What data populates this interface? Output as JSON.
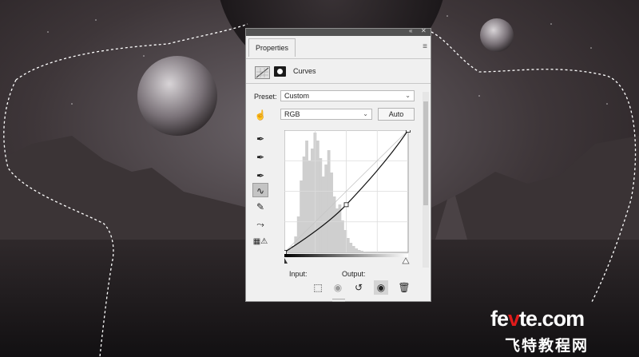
{
  "panel": {
    "tab_label": "Properties",
    "adjustment_title": "Curves",
    "preset_label": "Preset:",
    "preset_value": "Custom",
    "channel_value": "RGB",
    "auto_label": "Auto",
    "input_label": "Input:",
    "output_label": "Output:"
  },
  "curve": {
    "control_points": [
      [
        0,
        0
      ],
      [
        0.5,
        0.39
      ],
      [
        1,
        1
      ]
    ]
  },
  "tools": [
    "target-adjust-icon",
    "eyedropper-black-icon",
    "eyedropper-gray-icon",
    "eyedropper-white-icon",
    "curve-points-icon",
    "pencil-icon",
    "smooth-icon",
    "clipping-warning-icon"
  ],
  "bottom_icons": [
    "clip-to-layer-icon",
    "view-previous-icon",
    "reset-icon",
    "visibility-eye-icon",
    "trash-icon"
  ],
  "watermark": {
    "brand_pre": "fe",
    "brand_o": "v",
    "brand_post": "te.com",
    "chinese": "飞特教程网"
  },
  "colors": {
    "panel_bg": "#f0f0f0",
    "header_bar": "#535353",
    "sky_dark": "#2a2426",
    "watermark_red": "#e01b1b"
  }
}
